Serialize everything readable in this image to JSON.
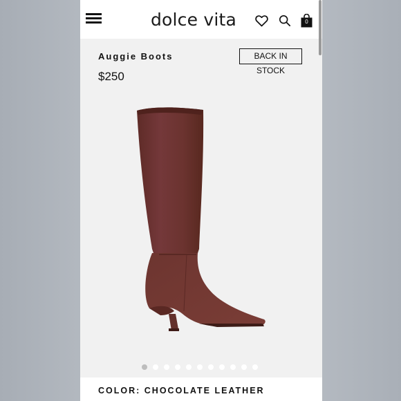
{
  "header": {
    "brand": "dolce vita",
    "bag_count": "0",
    "icons": [
      "menu-icon",
      "heart-icon",
      "search-icon",
      "bag-icon"
    ]
  },
  "product": {
    "name": "Auggie Boots",
    "price": "$250",
    "stock_badge": "BACK IN STOCK",
    "image_colors": {
      "leather": "#6e3530",
      "background": "#f1f1f1"
    }
  },
  "gallery": {
    "total_images": 11,
    "active_index": 0
  },
  "color": {
    "label": "COLOR: CHOCOLATE LEATHER"
  }
}
